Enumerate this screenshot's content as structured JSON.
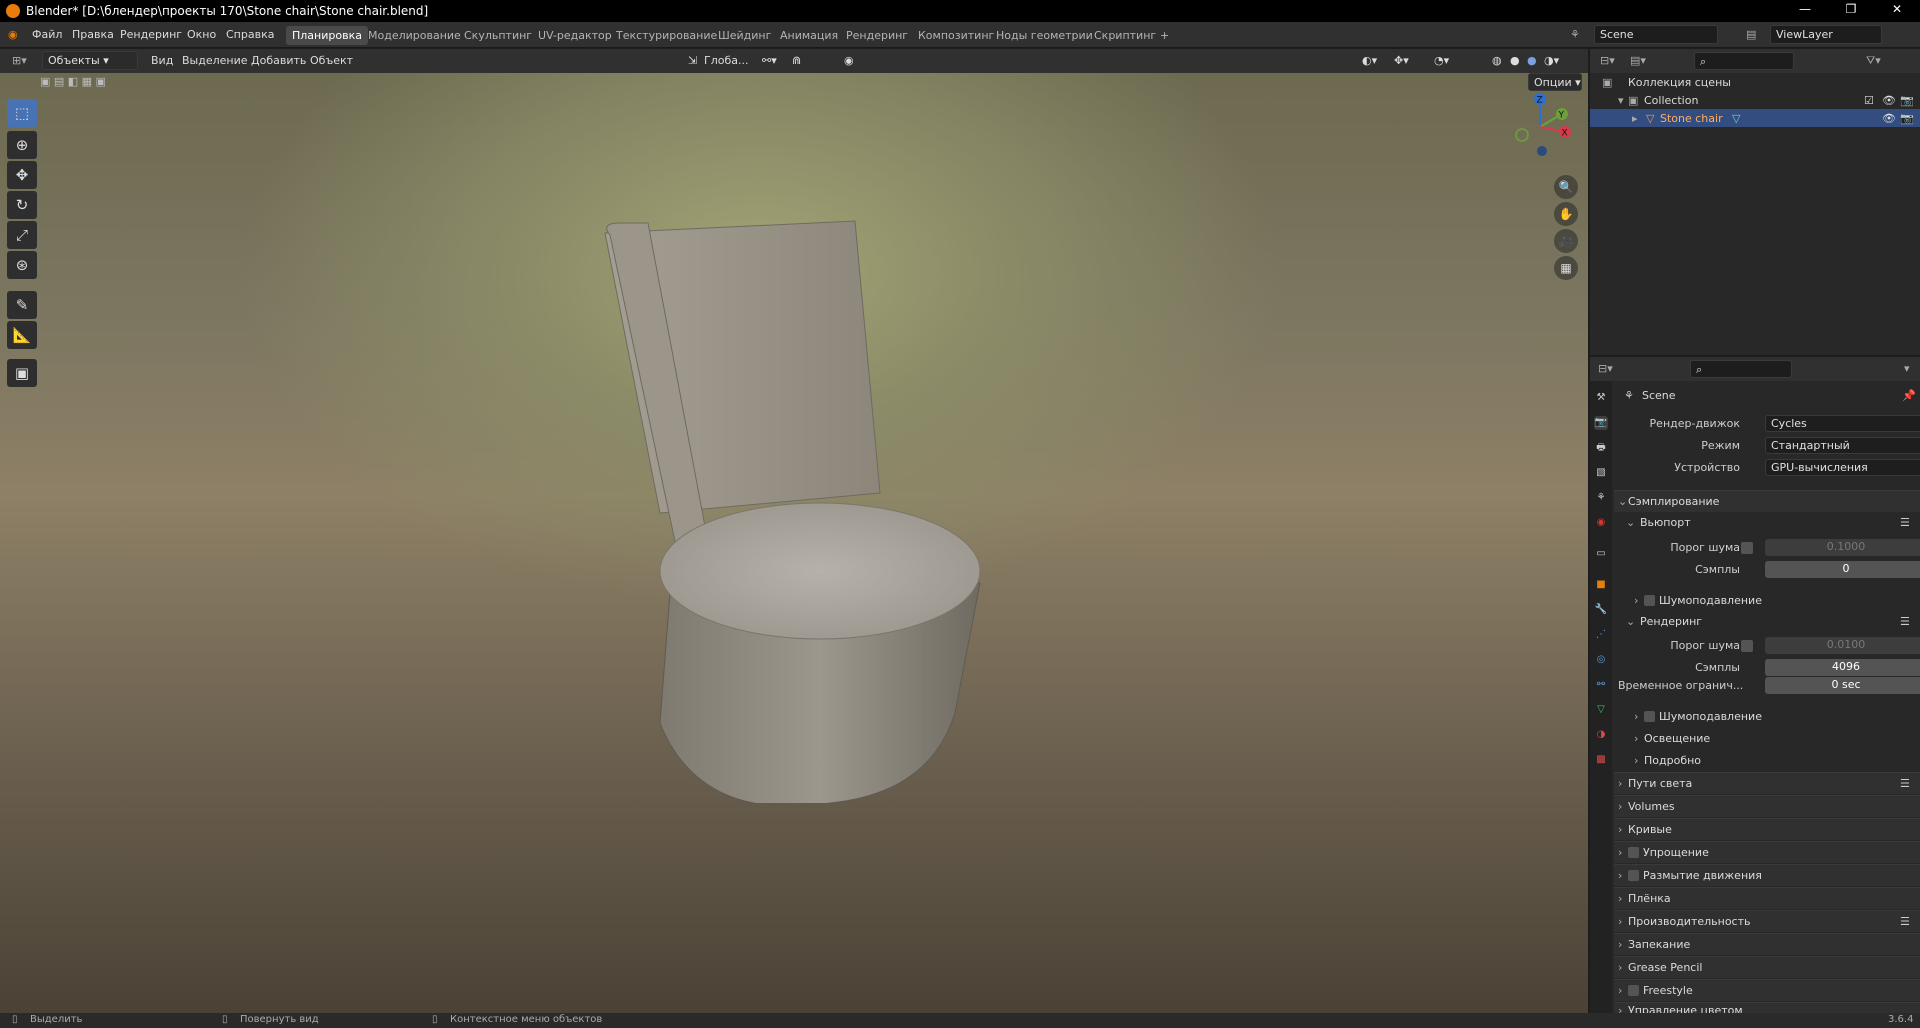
{
  "window": {
    "title": "Blender* [D:\\блендер\\проекты 170\\Stone chair\\Stone chair.blend]",
    "minimize": "—",
    "maximize": "❐",
    "close": "✕"
  },
  "menu": [
    "Файл",
    "Правка",
    "Рендеринг",
    "Окно",
    "Справка"
  ],
  "workspaces": [
    "Планировка",
    "Моделирование",
    "Скульптинг",
    "UV-редактор",
    "Текстурирование",
    "Шейдинг",
    "Анимация",
    "Рендеринг",
    "Композитинг",
    "Ноды геометрии",
    "Скриптинг",
    "+"
  ],
  "scene": {
    "name": "Scene",
    "view_layer": "ViewLayer"
  },
  "viewport_header": {
    "mode": "Объекты",
    "menus": [
      "Вид",
      "Выделение",
      "Добавить",
      "Объект"
    ],
    "orientation": "Глоба...",
    "options": "Опции"
  },
  "tools": [
    "select-box-icon",
    "cursor-icon",
    "move-icon",
    "rotate-icon",
    "scale-icon",
    "transform-icon",
    "annotate-icon",
    "measure-icon",
    "add-cube-icon"
  ],
  "gizmo": {
    "x": "X",
    "y": "Y",
    "z": "Z"
  },
  "outliner": {
    "root": "Коллекция сцены",
    "collection": "Collection",
    "object": "Stone chair"
  },
  "properties": {
    "scene_name": "Scene",
    "render_engine_label": "Рендер-движок",
    "render_engine": "Cycles",
    "mode_label": "Режим",
    "mode": "Стандартный",
    "device_label": "Устройство",
    "device": "GPU-вычисления",
    "sampling": "Сэмплирование",
    "viewport": "Вьюпорт",
    "noise_threshold_label": "Порог шума",
    "viewport_noise_threshold": "0.1000",
    "samples_label": "Сэмплы",
    "viewport_samples": "0",
    "denoise": "Шумоподавление",
    "render": "Рендеринг",
    "render_noise_threshold": "0.0100",
    "render_samples": "4096",
    "time_limit_label": "Временное огранич...",
    "time_limit": "0 sec",
    "lights": "Освещение",
    "advanced": "Подробно",
    "sections": [
      "Пути света",
      "Volumes",
      "Кривые",
      "Упрощение",
      "Размытие движения",
      "Плёнка",
      "Производительность",
      "Запекание",
      "Grease Pencil",
      "Freestyle",
      "Управление цветом"
    ]
  },
  "status": {
    "select": "Выделить",
    "rotate": "Повернуть вид",
    "context": "Контекстное меню объектов",
    "version": "3.6.4"
  }
}
